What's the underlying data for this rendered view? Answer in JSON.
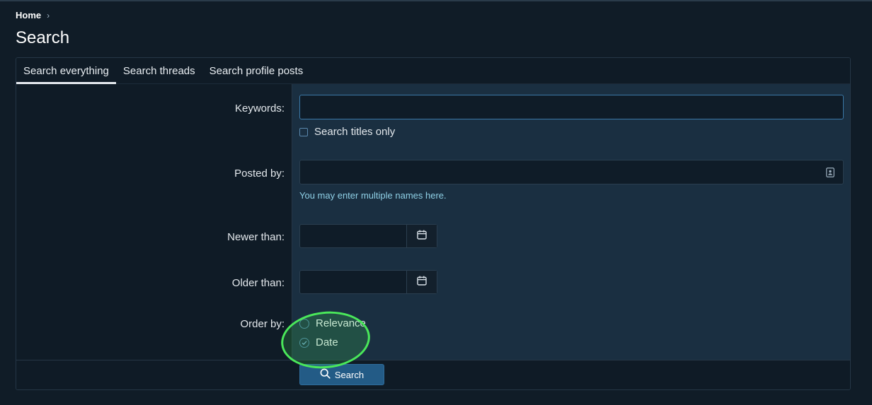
{
  "breadcrumb": {
    "home": "Home",
    "separator": "›"
  },
  "page": {
    "title": "Search"
  },
  "tabs": [
    {
      "label": "Search everything",
      "active": true
    },
    {
      "label": "Search threads",
      "active": false
    },
    {
      "label": "Search profile posts",
      "active": false
    }
  ],
  "form": {
    "keywords": {
      "label": "Keywords:",
      "value": "",
      "placeholder": ""
    },
    "titles_only": {
      "label": "Search titles only",
      "checked": false
    },
    "posted_by": {
      "label": "Posted by:",
      "value": "",
      "placeholder": "",
      "hint": "You may enter multiple names here.",
      "icon": "contact-card-icon"
    },
    "newer_than": {
      "label": "Newer than:",
      "value": "",
      "icon": "calendar-icon"
    },
    "older_than": {
      "label": "Older than:",
      "value": "",
      "icon": "calendar-icon"
    },
    "order_by": {
      "label": "Order by:",
      "options": [
        {
          "label": "Relevance",
          "selected": false
        },
        {
          "label": "Date",
          "selected": true
        }
      ]
    }
  },
  "footer": {
    "search_label": "Search",
    "search_icon": "search-icon"
  },
  "colors": {
    "background": "#101c27",
    "panel": "#1a2f41",
    "accent": "#235b86",
    "hint": "#8fd0e6",
    "highlight": "#4ae85a"
  }
}
